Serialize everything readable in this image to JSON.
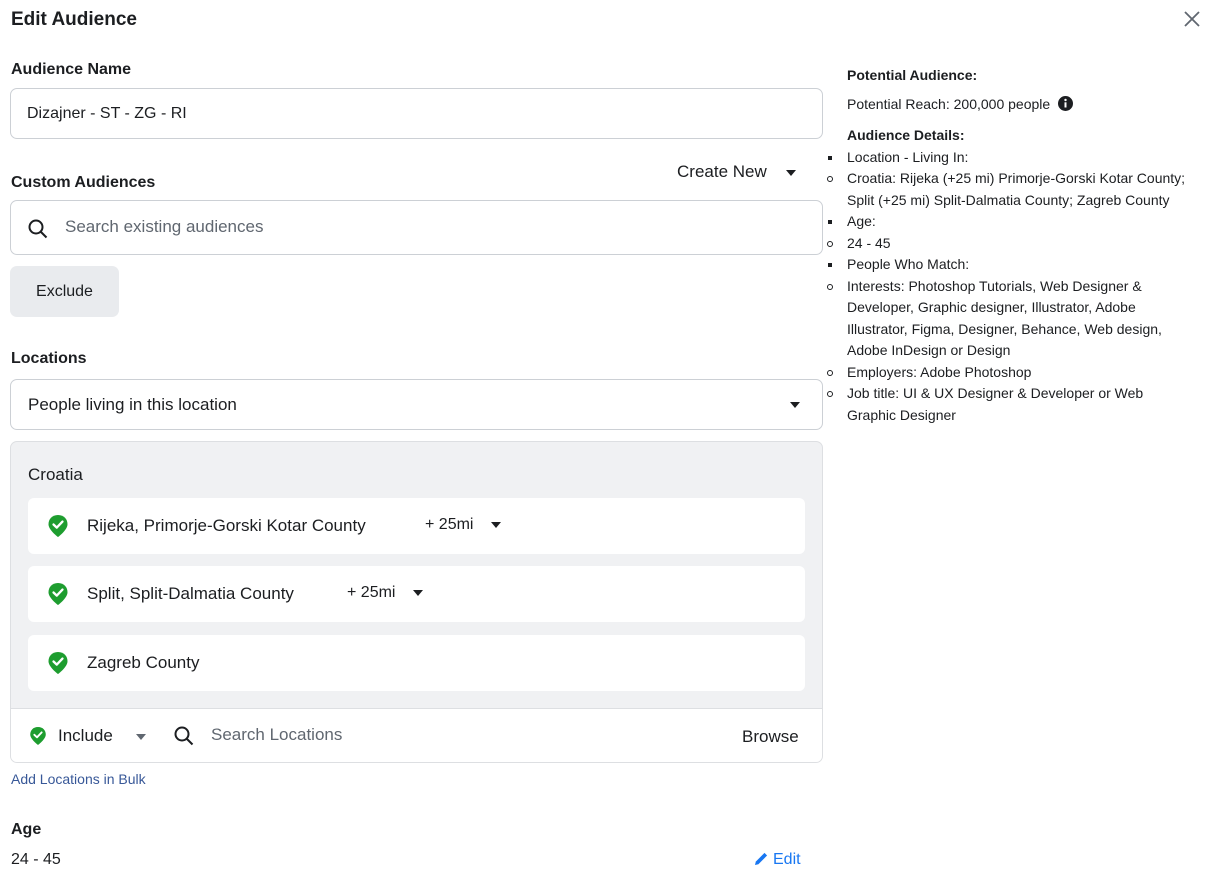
{
  "dialog": {
    "title": "Edit Audience"
  },
  "audience_name": {
    "label": "Audience Name",
    "value": "Dizajner - ST - ZG - RI"
  },
  "custom_audiences": {
    "label": "Custom Audiences",
    "create_new": "Create New",
    "search_placeholder": "Search existing audiences",
    "exclude_label": "Exclude"
  },
  "locations": {
    "label": "Locations",
    "type_selected": "People living in this location",
    "country": "Croatia",
    "items": [
      {
        "name": "Rijeka, Primorje-Gorski Kotar County",
        "radius": "+ 25mi"
      },
      {
        "name": "Split, Split-Dalmatia County",
        "radius": "+ 25mi"
      },
      {
        "name": "Zagreb County",
        "radius": ""
      }
    ],
    "include_label": "Include",
    "search_placeholder": "Search Locations",
    "browse_label": "Browse",
    "bulk_link": "Add Locations in Bulk"
  },
  "age": {
    "label": "Age",
    "value": "24 - 45",
    "edit_label": "Edit"
  },
  "potential": {
    "title": "Potential Audience:",
    "reach": "Potential Reach: 200,000 people",
    "details_title": "Audience Details:",
    "details": [
      {
        "bullet": "square",
        "text": "Location - Living In:"
      },
      {
        "bullet": "circle",
        "text": "Croatia: Rijeka (+25 mi) Primorje-Gorski Kotar County; Split (+25 mi) Split-Dalmatia County; Zagreb County"
      },
      {
        "bullet": "square",
        "text": "Age:"
      },
      {
        "bullet": "circle",
        "text": "24 - 45"
      },
      {
        "bullet": "square",
        "text": "People Who Match:"
      },
      {
        "bullet": "circle",
        "text": "Interests: Photoshop Tutorials, Web Designer & Developer, Graphic designer, Illustrator, Adobe Illustrator, Figma, Designer, Behance, Web design, Adobe InDesign or Design"
      },
      {
        "bullet": "circle",
        "text": "Employers: Adobe Photoshop"
      },
      {
        "bullet": "circle",
        "text": "Job title: UI & UX Designer & Developer or Web Graphic Designer"
      }
    ]
  },
  "colors": {
    "pin_green": "#1e9d2f",
    "link_blue": "#385898",
    "edit_blue": "#1877f2",
    "panel_bg": "#f0f1f3"
  }
}
